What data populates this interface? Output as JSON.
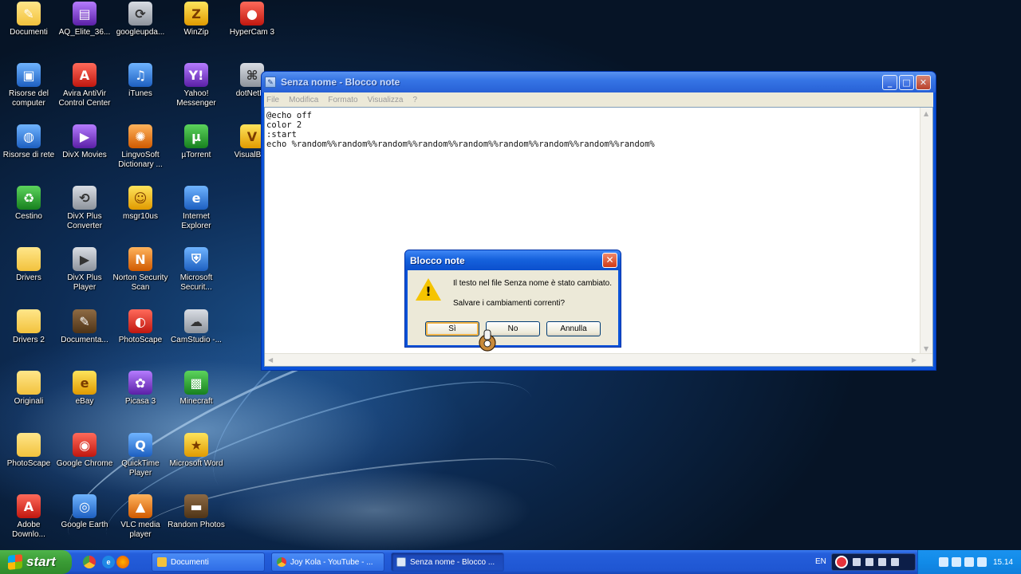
{
  "desktop": {
    "icons": [
      {
        "label": "Documenti",
        "glyph": "✎",
        "style": "folder",
        "icon": "documents-folder-icon"
      },
      {
        "label": "AQ_Elite_36...",
        "glyph": "▤",
        "style": "purple",
        "icon": "archive-icon"
      },
      {
        "label": "googleupda...",
        "glyph": "⟳",
        "style": "gray",
        "icon": "google-update-icon"
      },
      {
        "label": "WinZip",
        "glyph": "Z",
        "style": "yellow",
        "icon": "winzip-icon"
      },
      {
        "label": "HyperCam 3",
        "glyph": "●",
        "style": "red",
        "icon": "hypercam-icon"
      },
      {
        "label": "Risorse del computer",
        "glyph": "▣",
        "style": "blue",
        "icon": "my-computer-icon"
      },
      {
        "label": "Avira AntiVir Control Center",
        "glyph": "A",
        "style": "red",
        "icon": "avira-icon"
      },
      {
        "label": "iTunes",
        "glyph": "♫",
        "style": "blue",
        "icon": "itunes-icon"
      },
      {
        "label": "Yahoo! Messenger",
        "glyph": "Y!",
        "style": "purple",
        "icon": "yahoo-messenger-icon"
      },
      {
        "label": "dotNetFx",
        "glyph": "⌘",
        "style": "gray",
        "icon": "dotnetfx-icon"
      },
      {
        "label": "Risorse di rete",
        "glyph": "◍",
        "style": "blue",
        "icon": "network-icon"
      },
      {
        "label": "DivX Movies",
        "glyph": "▶",
        "style": "purple",
        "icon": "divx-movies-icon"
      },
      {
        "label": "LingvoSoft Dictionary ...",
        "glyph": "✺",
        "style": "orange",
        "icon": "lingvosoft-icon"
      },
      {
        "label": "µTorrent",
        "glyph": "µ",
        "style": "green",
        "icon": "utorrent-icon"
      },
      {
        "label": "VisualBee",
        "glyph": "V",
        "style": "yellow",
        "icon": "visualbee-icon"
      },
      {
        "label": "Cestino",
        "glyph": "♻",
        "style": "green",
        "icon": "recycle-bin-icon"
      },
      {
        "label": "DivX Plus Converter",
        "glyph": "⟲",
        "style": "gray",
        "icon": "divx-converter-icon"
      },
      {
        "label": "msgr10us",
        "glyph": "☺",
        "style": "yellow",
        "icon": "messenger-setup-icon"
      },
      {
        "label": "Internet Explorer",
        "glyph": "e",
        "style": "blue",
        "icon": "internet-explorer-icon"
      },
      {
        "label": "Drivers",
        "glyph": "",
        "style": "folder",
        "icon": "folder-icon"
      },
      {
        "label": "DivX Plus Player",
        "glyph": "▶",
        "style": "gray",
        "icon": "divx-player-icon"
      },
      {
        "label": "Norton Security Scan",
        "glyph": "N",
        "style": "orange",
        "icon": "norton-icon"
      },
      {
        "label": "Microsoft Securit...",
        "glyph": "⛨",
        "style": "blue",
        "icon": "microsoft-security-icon"
      },
      {
        "label": "Drivers 2",
        "glyph": "",
        "style": "folder",
        "icon": "folder-icon"
      },
      {
        "label": "Documenta...",
        "glyph": "✎",
        "style": "brown",
        "icon": "document-icon"
      },
      {
        "label": "PhotoScape",
        "glyph": "◐",
        "style": "red",
        "icon": "photoscape-icon"
      },
      {
        "label": "CamStudio -...",
        "glyph": "☁",
        "style": "gray",
        "icon": "camstudio-icon"
      },
      {
        "label": "Originali",
        "glyph": "",
        "style": "folder",
        "icon": "folder-icon"
      },
      {
        "label": "eBay",
        "glyph": "e",
        "style": "yellow",
        "icon": "ebay-icon"
      },
      {
        "label": "Picasa 3",
        "glyph": "✿",
        "style": "purple",
        "icon": "picasa-icon"
      },
      {
        "label": "Minecraft",
        "glyph": "▩",
        "style": "green",
        "icon": "minecraft-icon"
      },
      {
        "label": "PhotoScape",
        "glyph": "",
        "style": "folder",
        "icon": "folder-icon"
      },
      {
        "label": "Google Chrome",
        "glyph": "◉",
        "style": "red",
        "icon": "google-chrome-icon"
      },
      {
        "label": "QuickTime Player",
        "glyph": "Q",
        "style": "blue",
        "icon": "quicktime-icon"
      },
      {
        "label": "Microsoft Word",
        "glyph": "★",
        "style": "yellow",
        "icon": "star-icon"
      },
      {
        "label": "Adobe Downlo...",
        "glyph": "A",
        "style": "red",
        "icon": "adobe-icon"
      },
      {
        "label": "Google Earth",
        "glyph": "◎",
        "style": "blue",
        "icon": "google-earth-icon"
      },
      {
        "label": "VLC media player",
        "glyph": "▲",
        "style": "orange",
        "icon": "vlc-icon"
      },
      {
        "label": "Random Photos",
        "glyph": "▬",
        "style": "brown",
        "icon": "random-photos-icon"
      }
    ]
  },
  "notepad": {
    "title": "Senza nome - Blocco note",
    "title_icon": "notepad-icon",
    "menu": [
      "File",
      "Modifica",
      "Formato",
      "Visualizza",
      "?"
    ],
    "content": "@echo off\ncolor 2\n:start\necho %random%%random%%random%%random%%random%%random%%random%%random%%random%"
  },
  "dialog": {
    "title": "Blocco note",
    "icon": "warning-icon",
    "message": "Il testo nel file Senza nome è stato cambiato.",
    "question": "Salvare i cambiamenti correnti?",
    "buttons": {
      "yes": "Sì",
      "no": "No",
      "cancel": "Annulla"
    }
  },
  "taskbar": {
    "start_label": "start",
    "quick_launch": [
      "chrome-icon",
      "internet-explorer-icon",
      "firefox-icon"
    ],
    "tasks": [
      {
        "label": "Documenti",
        "icon": "folder-icon",
        "active": false
      },
      {
        "label": "Joy Kola - YouTube - ...",
        "icon": "chrome-icon",
        "active": false
      },
      {
        "label": "Senza nome - Blocco ...",
        "icon": "notepad-icon",
        "active": true
      }
    ],
    "language": "EN",
    "clock": "15.14"
  },
  "colors": {
    "title_active": "#0a52d8",
    "taskbar": "#245edb",
    "start": "#3a9b35",
    "tray": "#118be8"
  }
}
